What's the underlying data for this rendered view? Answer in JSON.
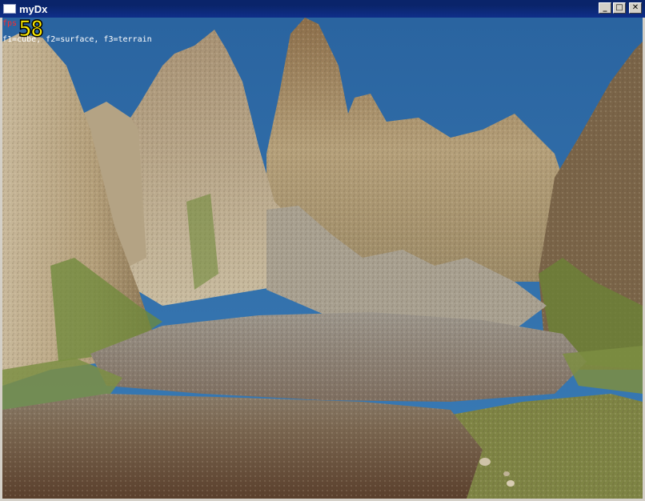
{
  "window": {
    "title": "myDx",
    "minimize_label": "_",
    "maximize_label": "□",
    "close_label": "✕",
    "icon": "app-window-icon"
  },
  "hud": {
    "fps_label": "fps",
    "fps_value": "58",
    "help_text": "f1=cube, f2=surface, f3=terrain"
  },
  "scene": {
    "sky_color": "#2e6fa8",
    "rock_color": "#a48f6a",
    "grass_color": "#6f8a3a",
    "ground_color": "#6a5440"
  }
}
